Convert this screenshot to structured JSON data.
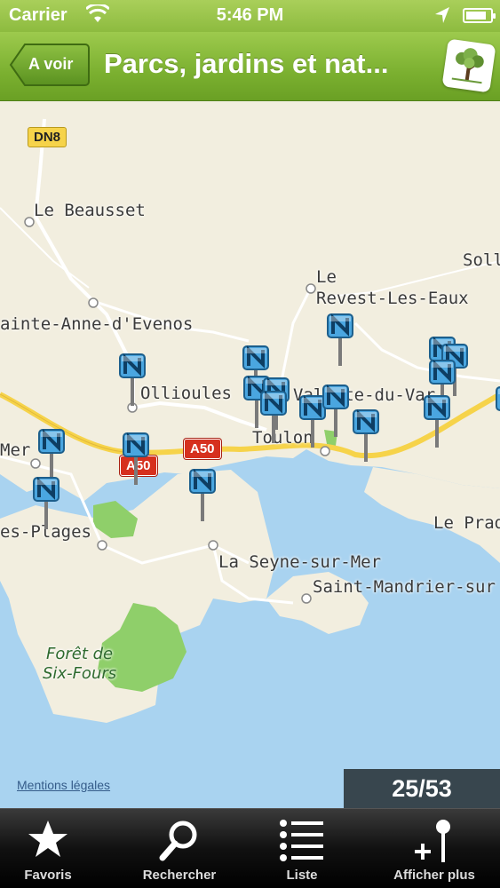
{
  "status_bar": {
    "carrier": "Carrier",
    "time": "5:46 PM",
    "battery_level": 0.85
  },
  "nav_bar": {
    "back_label": "A voir",
    "title": "Parcs, jardins et nat...",
    "logo_icon": "tree-logo-icon"
  },
  "map": {
    "labels": {
      "le_beausset": "Le Beausset",
      "sollies": "Soll",
      "le_revest": "Le\nRevest-Les-Eaux",
      "sainte_anne": "ainte-Anne-d'Evenos",
      "ollioules": "Ollioules",
      "valette": "Valette-du-Var",
      "toulon": "Toulon",
      "mer": "Mer",
      "les_plages": "es-Plages",
      "le_pradet": "Le Prad",
      "la_seyne": "La Seyne-sur-Mer",
      "saint_mandrier": "Saint-Mandrier-sur",
      "foret": "Forêt de\nSix-Fours"
    },
    "road_shields": {
      "dn8": "DN8",
      "a50_left": "A50",
      "a50_right": "A50"
    },
    "legal_link": "Mentions légales",
    "counter": "25/53"
  },
  "tab_bar": {
    "items": [
      {
        "label": "Favoris",
        "icon": "star-icon"
      },
      {
        "label": "Rechercher",
        "icon": "search-icon"
      },
      {
        "label": "Liste",
        "icon": "list-icon"
      },
      {
        "label": "Afficher plus",
        "icon": "add-pin-icon"
      }
    ]
  },
  "colors": {
    "nav_green": "#7bb030",
    "pin_blue": "#4aa6e0",
    "sea": "#a9d3f0",
    "land": "#f2eedf",
    "forest": "#8fcf6a"
  }
}
